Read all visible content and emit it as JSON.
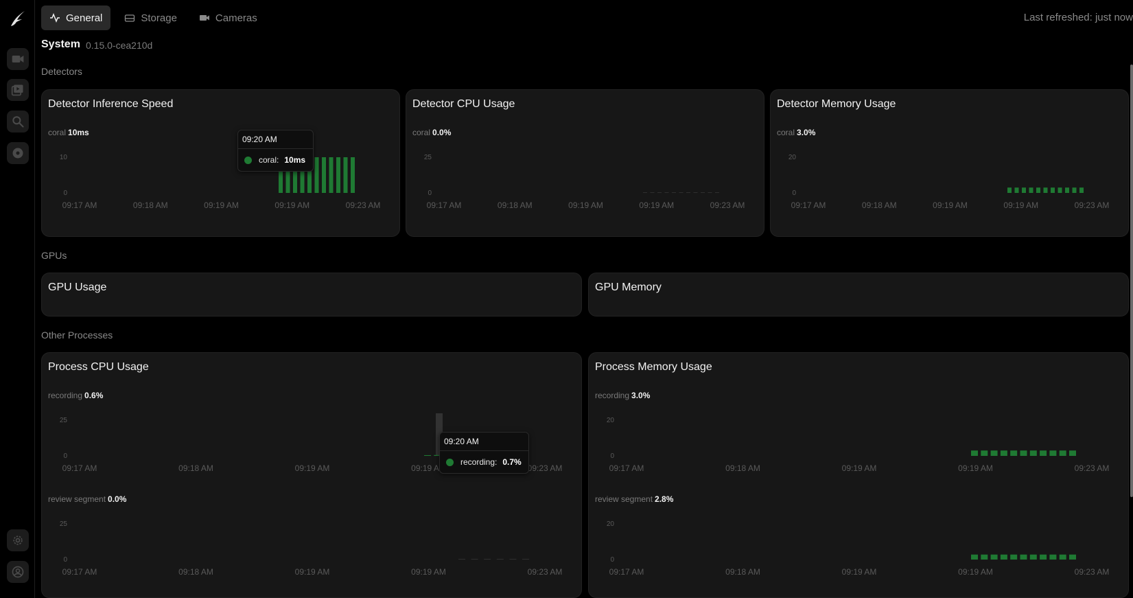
{
  "header": {
    "tabs": [
      {
        "label": "General",
        "icon": "activity-icon",
        "active": true
      },
      {
        "label": "Storage",
        "icon": "storage-icon",
        "active": false
      },
      {
        "label": "Cameras",
        "icon": "camera-icon",
        "active": false
      }
    ],
    "refreshed": "Last refreshed: just now"
  },
  "system": {
    "title": "System",
    "version": "0.15.0-cea210d"
  },
  "sections": {
    "detectors": "Detectors",
    "gpus": "GPUs",
    "other": "Other Processes"
  },
  "colors": {
    "accent": "#1f7a33",
    "background": "#000000",
    "card": "#171717"
  },
  "cards": {
    "inference": {
      "title": "Detector Inference Speed",
      "series": "coral",
      "value": "10ms"
    },
    "det_cpu": {
      "title": "Detector CPU Usage",
      "series": "coral",
      "value": "0.0%"
    },
    "det_mem": {
      "title": "Detector Memory Usage",
      "series": "coral",
      "value": "3.0%"
    },
    "gpu_usage": {
      "title": "GPU Usage"
    },
    "gpu_mem": {
      "title": "GPU Memory"
    },
    "proc_cpu": {
      "title": "Process CPU Usage",
      "series1": "recording",
      "value1": "0.6%",
      "series2": "review segment",
      "value2": "0.0%"
    },
    "proc_mem": {
      "title": "Process Memory Usage",
      "series1": "recording",
      "value1": "3.0%",
      "series2": "review segment",
      "value2": "2.8%"
    }
  },
  "tooltips": {
    "inference": {
      "time": "09:20 AM",
      "label": "coral:",
      "value": "10ms"
    },
    "proc_cpu": {
      "time": "09:20 AM",
      "label": "recording:",
      "value": "0.7%"
    }
  },
  "chart_data": [
    {
      "type": "bar",
      "name": "inference",
      "xticks": [
        "09:17 AM",
        "09:18 AM",
        "09:19 AM",
        "09:19 AM",
        "09:23 AM"
      ],
      "yticks": [
        "0",
        "10"
      ],
      "ylim": [
        0,
        10
      ],
      "series": [
        {
          "name": "coral",
          "values": [
            10,
            10,
            10,
            10,
            10,
            10,
            10,
            10,
            10,
            10,
            10
          ]
        }
      ]
    },
    {
      "type": "bar",
      "name": "det_cpu",
      "xticks": [
        "09:17 AM",
        "09:18 AM",
        "09:19 AM",
        "09:19 AM",
        "09:23 AM"
      ],
      "yticks": [
        "0",
        "25"
      ],
      "ylim": [
        0,
        25
      ],
      "series": [
        {
          "name": "coral",
          "values": [
            0,
            0,
            0,
            0,
            0,
            0,
            0,
            0,
            0,
            0,
            0
          ]
        }
      ]
    },
    {
      "type": "bar",
      "name": "det_mem",
      "xticks": [
        "09:17 AM",
        "09:18 AM",
        "09:19 AM",
        "09:19 AM",
        "09:23 AM"
      ],
      "yticks": [
        "0",
        "20"
      ],
      "ylim": [
        0,
        20
      ],
      "series": [
        {
          "name": "coral",
          "values": [
            3.0,
            3.0,
            3.0,
            3.0,
            3.0,
            3.0,
            3.0,
            3.0,
            3.0,
            3.0,
            3.0
          ]
        }
      ]
    },
    {
      "type": "bar",
      "name": "proc_cpu_recording",
      "xticks": [
        "09:17 AM",
        "09:18 AM",
        "09:19 AM",
        "09:19 AM",
        "09:23 AM"
      ],
      "yticks": [
        "0",
        "25"
      ],
      "ylim": [
        0,
        25
      ],
      "series": [
        {
          "name": "recording",
          "values": [
            0.5,
            0.6,
            0.6,
            0.7,
            0.6,
            0.6,
            0.5,
            0.6,
            0.6,
            0.5,
            0.6
          ]
        }
      ]
    },
    {
      "type": "bar",
      "name": "proc_cpu_review",
      "xticks": [
        "09:17 AM",
        "09:18 AM",
        "09:19 AM",
        "09:19 AM",
        "09:23 AM"
      ],
      "yticks": [
        "0",
        "25"
      ],
      "ylim": [
        0,
        25
      ],
      "series": [
        {
          "name": "review segment",
          "values": [
            0,
            0,
            0,
            0,
            0,
            0
          ]
        }
      ]
    },
    {
      "type": "bar",
      "name": "proc_mem_recording",
      "xticks": [
        "09:17 AM",
        "09:18 AM",
        "09:19 AM",
        "09:19 AM",
        "09:23 AM"
      ],
      "yticks": [
        "0",
        "20"
      ],
      "ylim": [
        0,
        20
      ],
      "series": [
        {
          "name": "recording",
          "values": [
            3.0,
            3.0,
            3.0,
            3.0,
            3.0,
            3.0,
            3.0,
            3.0,
            3.0,
            3.0,
            3.0
          ]
        }
      ]
    },
    {
      "type": "bar",
      "name": "proc_mem_review",
      "xticks": [
        "09:17 AM",
        "09:18 AM",
        "09:19 AM",
        "09:19 AM",
        "09:23 AM"
      ],
      "yticks": [
        "0",
        "20"
      ],
      "ylim": [
        0,
        20
      ],
      "series": [
        {
          "name": "review segment",
          "values": [
            2.8,
            2.8,
            2.8,
            2.8,
            2.8,
            2.8,
            2.8,
            2.8,
            2.8,
            2.8,
            2.8
          ]
        }
      ]
    }
  ]
}
